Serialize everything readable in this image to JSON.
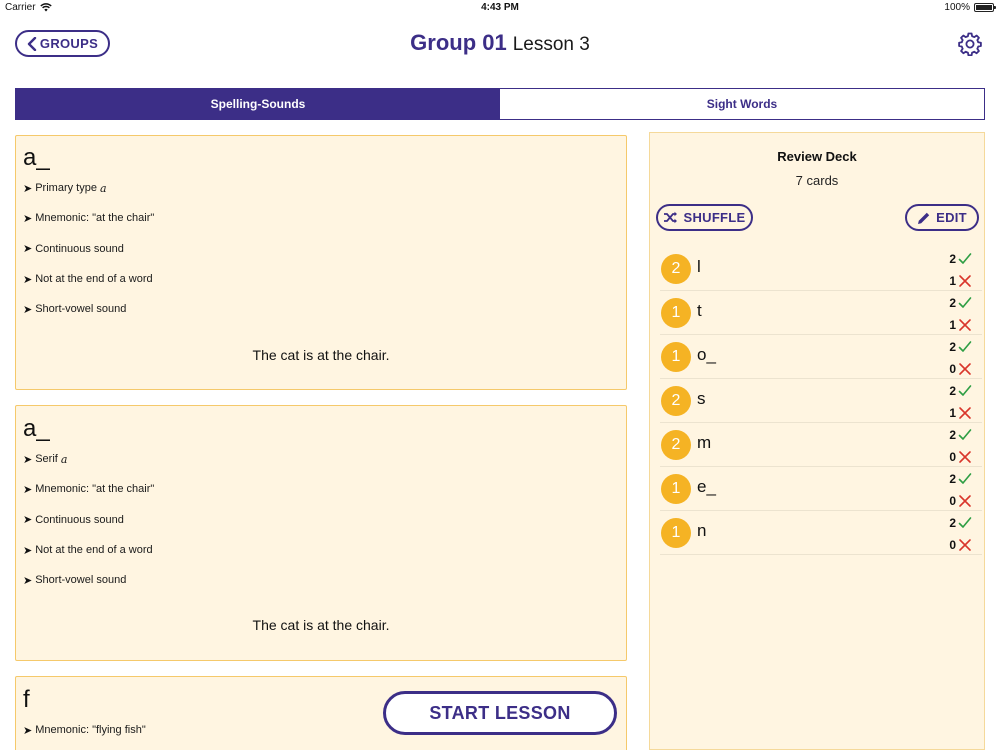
{
  "status_bar": {
    "carrier": "Carrier",
    "time": "4:43 PM",
    "battery": "100%"
  },
  "header": {
    "back_label": "GROUPS",
    "group_title": "Group 01",
    "lesson_title": "Lesson 3"
  },
  "tabs": [
    {
      "label": "Spelling-Sounds",
      "active": true
    },
    {
      "label": "Sight Words",
      "active": false
    }
  ],
  "cards": [
    {
      "glyph": "a_",
      "points": [
        {
          "text": "Primary type",
          "italic": "a"
        },
        {
          "text": "Mnemonic: \"at the chair\""
        },
        {
          "text": "Continuous sound"
        },
        {
          "text": "Not at the end of a word"
        },
        {
          "text": "Short-vowel sound"
        }
      ],
      "sentence": "The cat is at the chair."
    },
    {
      "glyph": "a_",
      "points": [
        {
          "text": "Serif",
          "italic": "a"
        },
        {
          "text": "Mnemonic: \"at the chair\""
        },
        {
          "text": "Continuous sound"
        },
        {
          "text": "Not at the end of a word"
        },
        {
          "text": "Short-vowel sound"
        }
      ],
      "sentence": "The cat is at the chair."
    },
    {
      "glyph": "f",
      "points": [
        {
          "text": "Mnemonic: \"flying fish\""
        }
      ]
    }
  ],
  "start_button_label": "START LESSON",
  "review_deck": {
    "title": "Review Deck",
    "count_label": "7 cards",
    "shuffle_label": "SHUFFLE",
    "edit_label": "EDIT",
    "items": [
      {
        "badge": "2",
        "letter": "l",
        "correct": "2",
        "wrong": "1"
      },
      {
        "badge": "1",
        "letter": "t",
        "correct": "2",
        "wrong": "1"
      },
      {
        "badge": "1",
        "letter": "o_",
        "correct": "2",
        "wrong": "0"
      },
      {
        "badge": "2",
        "letter": "s",
        "correct": "2",
        "wrong": "1"
      },
      {
        "badge": "2",
        "letter": "m",
        "correct": "2",
        "wrong": "0"
      },
      {
        "badge": "1",
        "letter": "e_",
        "correct": "2",
        "wrong": "0"
      },
      {
        "badge": "1",
        "letter": "n",
        "correct": "2",
        "wrong": "0"
      }
    ]
  },
  "colors": {
    "brand": "#3c2e87",
    "card_bg": "#fff5e1",
    "card_border": "#f5c96b",
    "badge": "#f5b324",
    "check": "#2e9e44",
    "cross": "#d9362b"
  },
  "icons": [
    "wifi-icon",
    "battery-icon",
    "chevron-left-icon",
    "gear-icon",
    "shuffle-icon",
    "pencil-icon",
    "check-icon",
    "cross-icon"
  ]
}
